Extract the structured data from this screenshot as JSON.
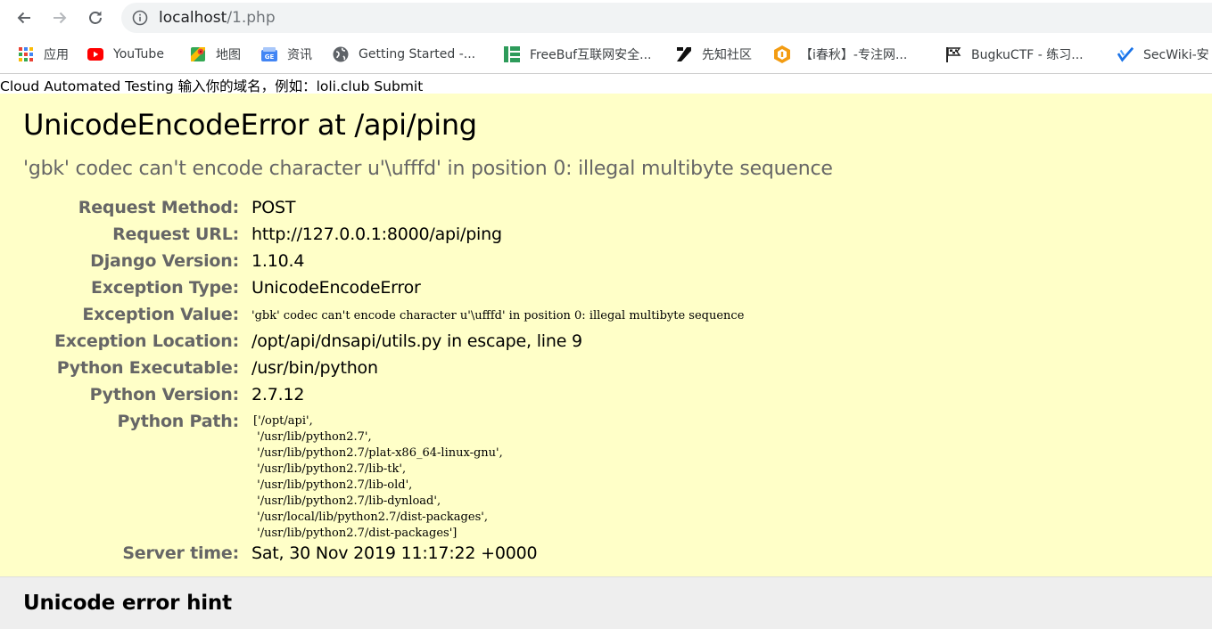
{
  "browser": {
    "url_host": "localhost",
    "url_path": "/1.php"
  },
  "bookmarks": [
    {
      "label": "应用",
      "icon": "apps-grid-icon"
    },
    {
      "label": "YouTube",
      "icon": "youtube-icon"
    },
    {
      "label": "地图",
      "icon": "maps-icon"
    },
    {
      "label": "资讯",
      "icon": "news-icon"
    },
    {
      "label": "Getting Started -...",
      "icon": "globe-icon"
    },
    {
      "label": "FreeBuf互联网安全...",
      "icon": "freebuf-icon"
    },
    {
      "label": "先知社区",
      "icon": "xianzhi-icon"
    },
    {
      "label": "【i春秋】-专注网...",
      "icon": "ichunqiu-icon"
    },
    {
      "label": "BugkuCTF - 练习...",
      "icon": "flag-icon"
    },
    {
      "label": "SecWiki-安",
      "icon": "secwiki-icon"
    }
  ],
  "form": {
    "text": "Cloud Automated Testing 输入你的域名，例如：loli.club Submit"
  },
  "error": {
    "title": "UnicodeEncodeError at /api/ping",
    "subtitle": "'gbk' codec can't encode character u'\\ufffd' in position 0: illegal multibyte sequence",
    "meta": [
      {
        "key": "Request Method:",
        "value": "POST"
      },
      {
        "key": "Request URL:",
        "value": "http://127.0.0.1:8000/api/ping"
      },
      {
        "key": "Django Version:",
        "value": "1.10.4"
      },
      {
        "key": "Exception Type:",
        "value": "UnicodeEncodeError"
      },
      {
        "key": "Exception Value:",
        "value": "'gbk' codec can't encode character u'\\ufffd' in position 0: illegal multibyte sequence"
      },
      {
        "key": "Exception Location:",
        "value": "/opt/api/dnsapi/utils.py in escape, line 9"
      },
      {
        "key": "Python Executable:",
        "value": "/usr/bin/python"
      },
      {
        "key": "Python Version:",
        "value": "2.7.12"
      },
      {
        "key": "Python Path:",
        "value": ""
      },
      {
        "key": "Server time:",
        "value": "Sat, 30 Nov 2019 11:17:22 +0000"
      }
    ],
    "python_path": "['/opt/api',\n '/usr/lib/python2.7',\n '/usr/lib/python2.7/plat-x86_64-linux-gnu',\n '/usr/lib/python2.7/lib-tk',\n '/usr/lib/python2.7/lib-old',\n '/usr/lib/python2.7/lib-dynload',\n '/usr/local/lib/python2.7/dist-packages',\n '/usr/lib/python2.7/dist-packages']"
  },
  "hint": {
    "title": "Unicode error hint"
  }
}
